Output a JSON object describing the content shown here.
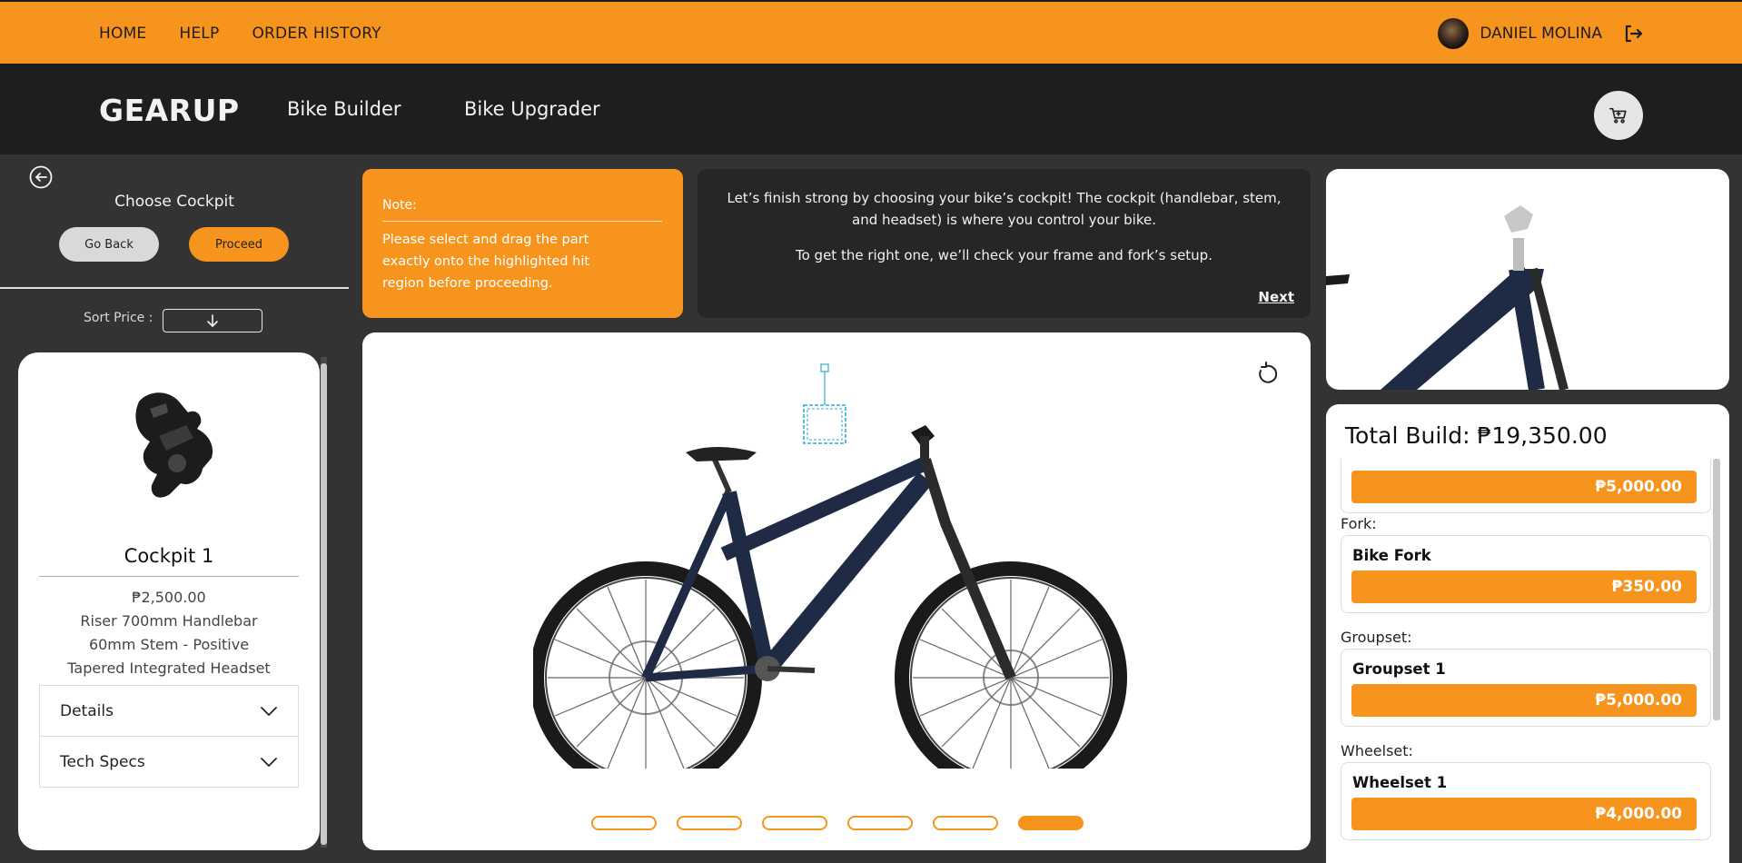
{
  "topnav": {
    "home": "HOME",
    "help": "HELP",
    "order_history": "ORDER HISTORY"
  },
  "user": {
    "name": "DANIEL MOLINA"
  },
  "header": {
    "logo": "GEARUP",
    "bike_builder": "Bike Builder",
    "bike_upgrader": "Bike Upgrader"
  },
  "sidebar": {
    "title": "Choose Cockpit",
    "go_back": "Go Back",
    "proceed": "Proceed",
    "sort_label": "Sort Price :",
    "card": {
      "title": "Cockpit 1",
      "price": "₱2,500.00",
      "line1": "Riser 700mm Handlebar",
      "line2": "60mm Stem - Positive",
      "line3": "Tapered Integrated Headset",
      "details": "Details",
      "tech_specs": "Tech Specs"
    }
  },
  "note": {
    "title": "Note:",
    "text": "Please select and drag the part exactly onto the highlighted hit region before proceeding."
  },
  "info": {
    "p1": "Let’s finish strong by choosing your bike’s cockpit! The cockpit (handlebar, stem, and headset) is where you control your bike.",
    "p2": "To get the right one, we’ll check your frame and fork’s setup.",
    "next": "Next"
  },
  "steps": {
    "count": 6,
    "active_index": 5
  },
  "summary": {
    "total": "Total Build: ₱19,350.00",
    "items": [
      {
        "label": "",
        "name": "",
        "price": "₱5,000.00"
      },
      {
        "label": "Fork:",
        "name": "Bike Fork",
        "price": "₱350.00"
      },
      {
        "label": "Groupset:",
        "name": "Groupset 1",
        "price": "₱5,000.00"
      },
      {
        "label": "Wheelset:",
        "name": "Wheelset 1",
        "price": "₱4,000.00"
      }
    ]
  },
  "colors": {
    "accent": "#f7941d",
    "dark": "#1e1e1e",
    "panel": "#333333"
  }
}
